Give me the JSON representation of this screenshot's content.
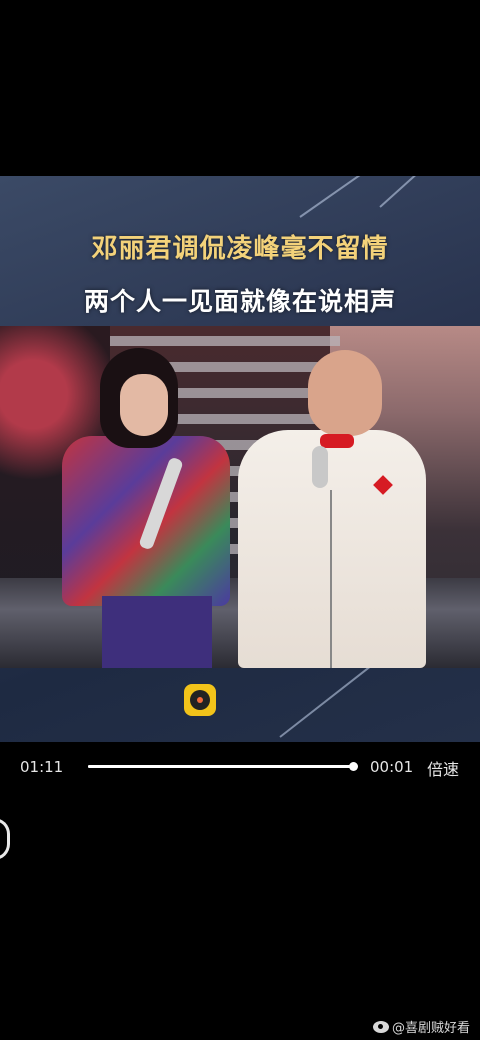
{
  "video": {
    "caption_line1": "邓丽君调侃凌峰毫不留情",
    "caption_line2": "两个人一见面就像在说相声"
  },
  "player": {
    "current_time": "01:11",
    "remaining_time": "00:01",
    "speed_label": "倍速",
    "progress": 0.99
  },
  "watermark": {
    "handle": "@喜剧贼好看"
  },
  "colors": {
    "caption_gold": "#f3d27a",
    "logo_yellow": "#f2c31a",
    "accent_red": "#d61b23"
  }
}
